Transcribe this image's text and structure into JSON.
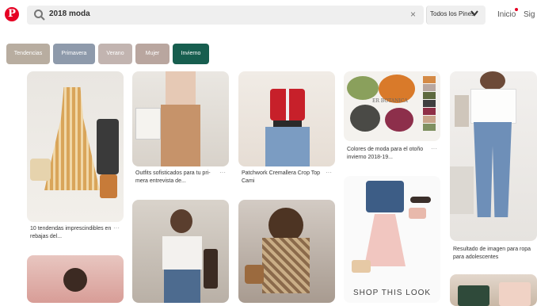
{
  "header": {
    "search_query": "2018 moda",
    "clear_icon": "×",
    "filter_label": "Todos los Pines",
    "nav_home": "Inicio",
    "nav_following": "Sig"
  },
  "chips": [
    "Tendencias",
    "Primavera",
    "Verano",
    "Mujer",
    "Invierno"
  ],
  "chip_colors": [
    "#b8ada0",
    "#8e9aab",
    "#c2b4b0",
    "#b9a69f",
    "#175e4f"
  ],
  "pins": [
    {
      "caption": "10 tendendas imprescindibles en rebajas del..."
    },
    {
      "caption": "Outfits sofisticados para tu pri-mera entrevista de..."
    },
    {
      "caption": "Patchwork Cremallera Crop Top Cami"
    },
    {
      "caption": "Colores de moda para el otoño invierno 2018-19..."
    },
    {
      "caption": "Resultado de imagen para ropa para adolescentes"
    }
  ],
  "pin_overlays": {
    "botanica_text": "ER BOTANICA",
    "shop_text": "SHOP THIS LOOK"
  },
  "more_icon": "···"
}
